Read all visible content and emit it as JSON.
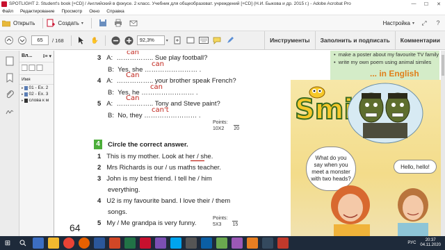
{
  "window": {
    "title": "SPOTLIGHT 2. Student's book [+CD] / Английский в фокусе. 2 класс. Учебник для общеобразоват. учреждений [+CD] (Н.И. Быкова и др. 2015 г.) - Adobe Acrobat Pro",
    "minimize": "—",
    "maximize": "☐",
    "close": "✕"
  },
  "menu": [
    "Файл",
    "Редактирование",
    "Просмотр",
    "Окно",
    "Справка"
  ],
  "toolbar": {
    "open_label": "Открыть",
    "create_label": "Создать",
    "customize_label": "Настройка"
  },
  "nav": {
    "page_value": "65",
    "page_total": "/ 168",
    "zoom_value": "92,3%"
  },
  "right_tabs": [
    "Инструменты",
    "Заполнить и подписать",
    "Комментарии"
  ],
  "panel": {
    "header": "Вл...",
    "options_label": "⁝≡ ▾",
    "column": "Имя",
    "items": [
      "01 - Ex. 2",
      "02 - Ex. 3",
      "слова к м"
    ]
  },
  "page": {
    "number": "64",
    "ex3": {
      "lines": [
        {
          "num": "3",
          "speaker": "A:",
          "text": "…………….. Sue play football?"
        },
        {
          "num": "",
          "speaker": "B:",
          "text": "Yes, she …………………… ."
        },
        {
          "num": "4",
          "speaker": "A:",
          "text": "…………….. your brother speak French?"
        },
        {
          "num": "",
          "speaker": "B:",
          "text": "Yes, he …………………… ."
        },
        {
          "num": "5",
          "speaker": "A:",
          "text": "…………….. Tony and Steve paint?"
        },
        {
          "num": "",
          "speaker": "B:",
          "text": "No, they …………………… ."
        }
      ],
      "handwriting": [
        "can",
        "can",
        "Can",
        "can",
        "Can",
        "can't"
      ],
      "points_label": "Points:",
      "points_calc": "10X2",
      "points_total": "20"
    },
    "ex4": {
      "badge": "4",
      "title": "Circle the correct answer.",
      "lines": [
        {
          "num": "1",
          "text": "This is my mother. Look at her / she."
        },
        {
          "num": "2",
          "text": "Mrs Richards is our / us maths teacher."
        },
        {
          "num": "3",
          "text": "John is my best friend. I tell he / him"
        },
        {
          "num": "",
          "text": "everything."
        },
        {
          "num": "4",
          "text": "U2 is my favourite band. I love their / them"
        },
        {
          "num": "",
          "text": "songs."
        },
        {
          "num": "5",
          "text": "My / Me grandpa is very funny."
        }
      ],
      "points_label": "Points:",
      "points_calc": "5X3",
      "points_total": "15"
    },
    "right": {
      "bullets": [
        "make a poster about my favourite TV family",
        "write my own poem using animal similes"
      ],
      "in_english": "... in English",
      "smile": "Smile",
      "bubble_left": "What do you say when you meet a monster with two heads?",
      "bubble_right": "Hello, hello!"
    }
  },
  "taskbar": {
    "time": "20:37",
    "date": "04.11.2020",
    "lang": "РУС"
  },
  "colors": {
    "handwriting": "#c0241b",
    "exercise_badge": "#4cae3a",
    "in_english": "#e07f1a",
    "taskbar": "#1e2a3a"
  }
}
